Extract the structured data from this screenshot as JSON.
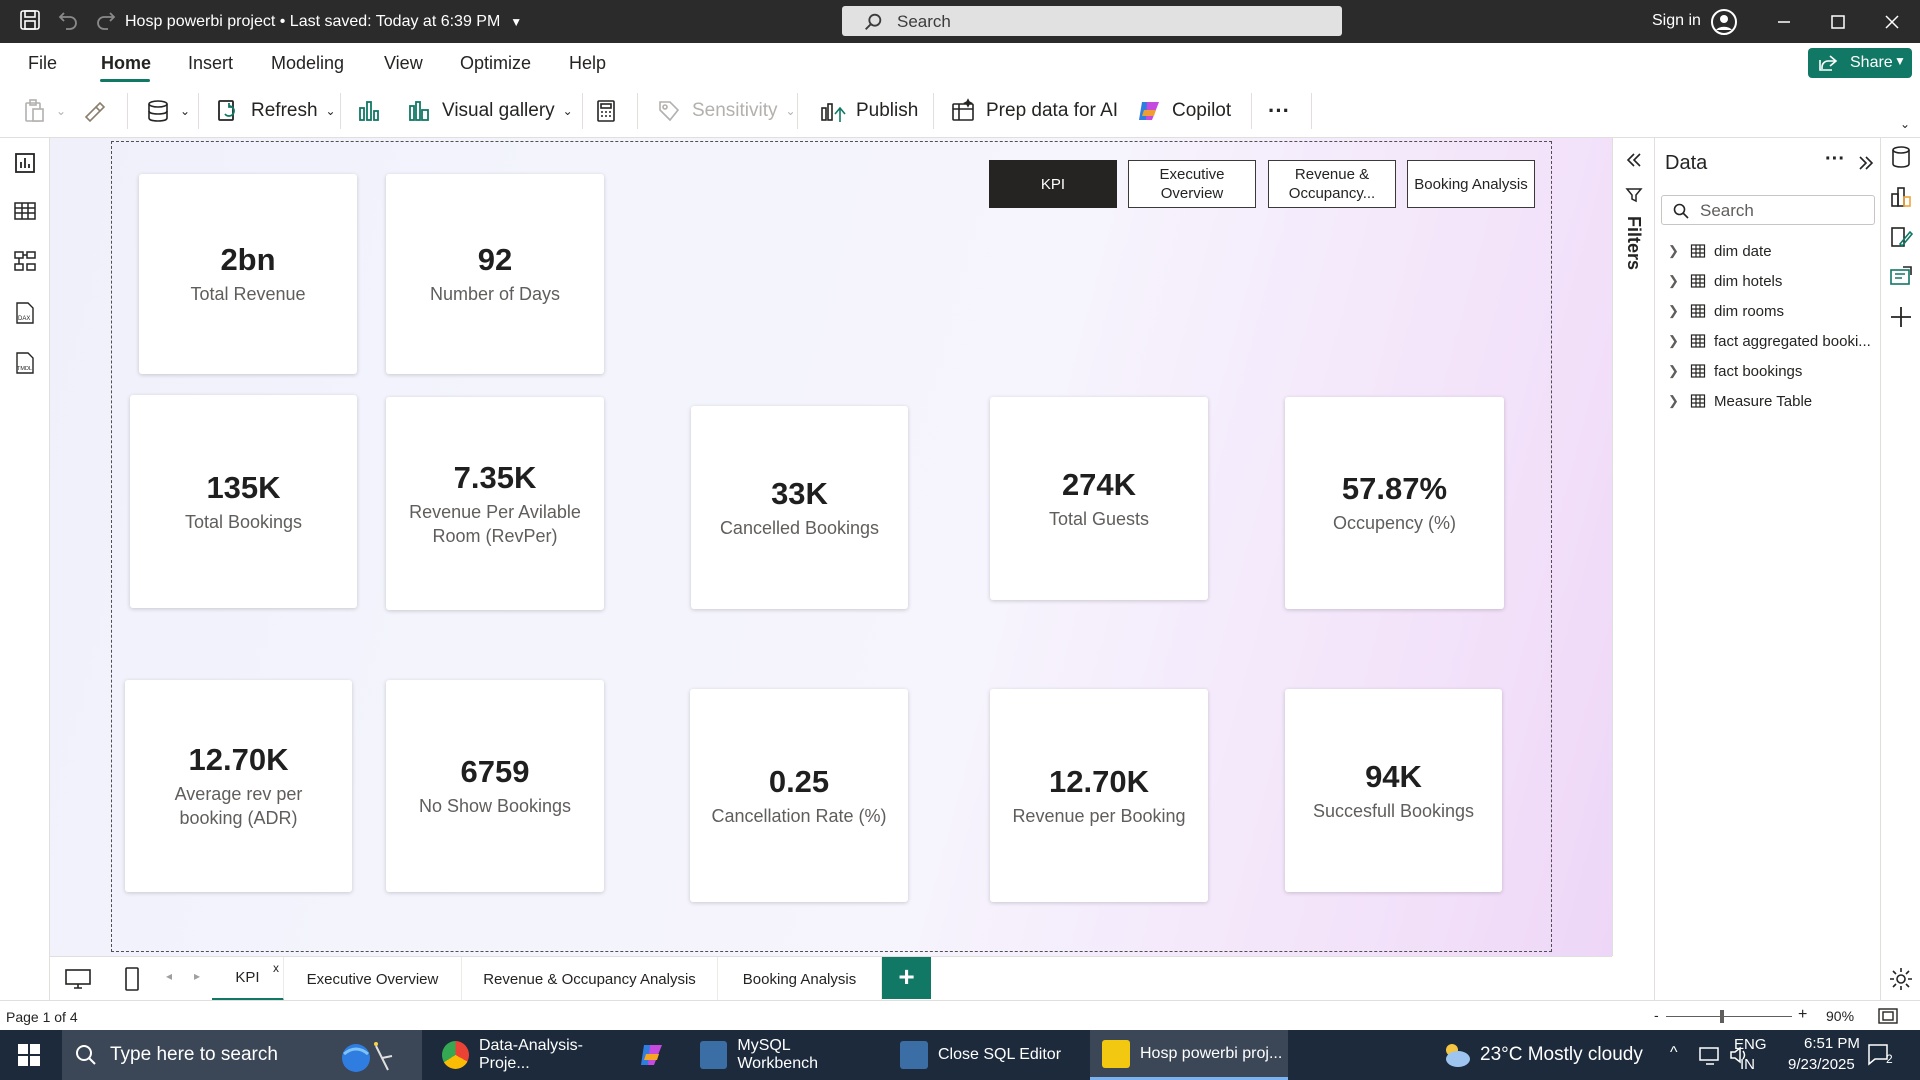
{
  "titlebar": {
    "title": "Hosp powerbi project",
    "saved": " • Last saved: Today at 6:39 PM",
    "search_placeholder": "Search",
    "sign_in": "Sign in"
  },
  "menu": {
    "tabs": [
      "File",
      "Home",
      "Insert",
      "Modeling",
      "View",
      "Optimize",
      "Help"
    ],
    "active": "Home",
    "share": "Share"
  },
  "toolbar": {
    "refresh": "Refresh",
    "visual_gallery": "Visual gallery",
    "sensitivity": "Sensitivity",
    "publish": "Publish",
    "prep_data": "Prep data for AI",
    "copilot": "Copilot",
    "more": "···"
  },
  "nav_buttons": [
    {
      "label": "KPI",
      "active": true
    },
    {
      "label": "Executive Overview",
      "active": false
    },
    {
      "label": "Revenue & Occupancy...",
      "active": false
    },
    {
      "label": "Booking Analysis",
      "active": false
    }
  ],
  "cards": [
    {
      "value": "2bn",
      "label": "Total Revenue"
    },
    {
      "value": "92",
      "label": "Number of Days"
    },
    {
      "value": "135K",
      "label": "Total Bookings"
    },
    {
      "value": "7.35K",
      "label": "Revenue Per Avilable Room (RevPer)"
    },
    {
      "value": "33K",
      "label": "Cancelled Bookings"
    },
    {
      "value": "274K",
      "label": "Total Guests"
    },
    {
      "value": "57.87%",
      "label": "Occupency  (%)"
    },
    {
      "value": "12.70K",
      "label": "Average rev per booking (ADR)"
    },
    {
      "value": "6759",
      "label": "No Show Bookings"
    },
    {
      "value": "0.25",
      "label": "Cancellation Rate (%)"
    },
    {
      "value": "12.70K",
      "label": "Revenue per Booking"
    },
    {
      "value": "94K",
      "label": "Succesfull Bookings"
    }
  ],
  "filters_pane": {
    "label": "Filters"
  },
  "data_pane": {
    "title": "Data",
    "search_placeholder": "Search",
    "tables": [
      "dim date",
      "dim hotels",
      "dim rooms",
      "fact aggregated booki...",
      "fact bookings",
      "Measure Table"
    ]
  },
  "page_tabs": {
    "tabs": [
      "KPI",
      "Executive Overview",
      "Revenue & Occupancy Analysis",
      "Booking Analysis"
    ],
    "active": "KPI",
    "close": "x",
    "add": "+"
  },
  "status": {
    "page": "Page 1 of 4",
    "zoom": "90%",
    "zoom_minus": "-",
    "zoom_plus": "+"
  },
  "taskbar": {
    "search_placeholder": "Type here to search",
    "apps": [
      "Data-Analysis-Proje...",
      "MySQL Workbench",
      "Close SQL Editor",
      "Hosp powerbi proj..."
    ],
    "weather": "23°C  Mostly cloudy",
    "lang1": "ENG",
    "lang2": "IN",
    "time": "6:51 PM",
    "date": "9/23/2025",
    "notifications": "2"
  },
  "colors": {
    "accent": "#117865",
    "taskbar": "#1c2a3b",
    "titlebar": "#2b2b2b"
  }
}
